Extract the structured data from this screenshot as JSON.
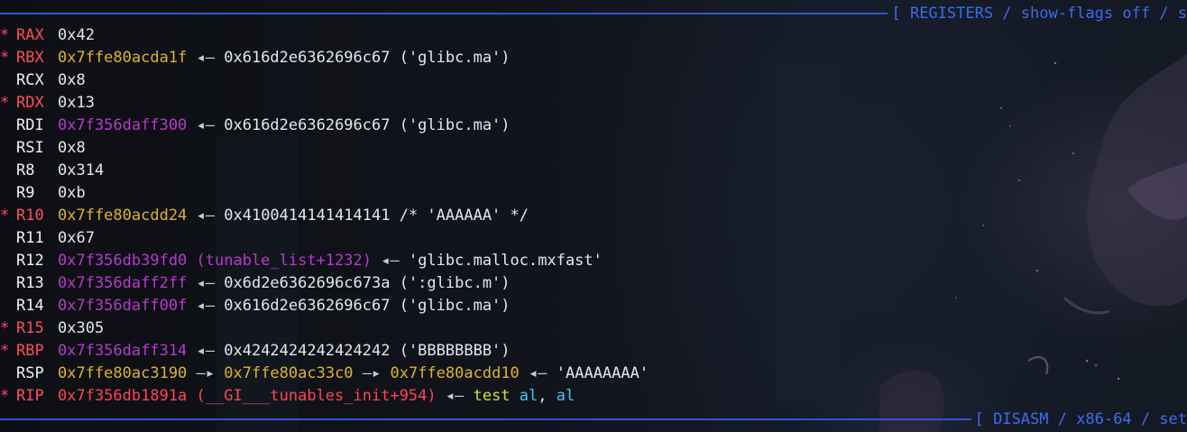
{
  "headers": {
    "registers": "[ REGISTERS / show-flags off / s",
    "disasm": "[ DISASM / x86-64 / set"
  },
  "registers": [
    {
      "changed": true,
      "name": "RAX",
      "value": "0x42",
      "value_kind": "plain",
      "arrow": "",
      "rest": ""
    },
    {
      "changed": true,
      "name": "RBX",
      "value": "0x7ffe80acda1f",
      "value_kind": "stack",
      "arrow": " ◂— ",
      "rest": "0x616d2e6362696c67 ('glibc.ma')"
    },
    {
      "changed": false,
      "name": "RCX",
      "value": "0x8",
      "value_kind": "plain",
      "arrow": "",
      "rest": ""
    },
    {
      "changed": true,
      "name": "RDX",
      "value": "0x13",
      "value_kind": "plain",
      "arrow": "",
      "rest": ""
    },
    {
      "changed": false,
      "name": "RDI",
      "value": "0x7f356daff300",
      "value_kind": "data",
      "arrow": " ◂— ",
      "rest": "0x616d2e6362696c67 ('glibc.ma')"
    },
    {
      "changed": false,
      "name": "RSI",
      "value": "0x8",
      "value_kind": "plain",
      "arrow": "",
      "rest": ""
    },
    {
      "changed": false,
      "name": "R8",
      "value": "0x314",
      "value_kind": "plain",
      "arrow": "",
      "rest": ""
    },
    {
      "changed": false,
      "name": "R9",
      "value": "0xb",
      "value_kind": "plain",
      "arrow": "",
      "rest": ""
    },
    {
      "changed": true,
      "name": "R10",
      "value": "0x7ffe80acdd24",
      "value_kind": "stack",
      "arrow": " ◂— ",
      "rest": "0x4100414141414141 /* 'AAAAAA' */"
    },
    {
      "changed": false,
      "name": "R11",
      "value": "0x67",
      "value_kind": "plain",
      "arrow": "",
      "rest": ""
    },
    {
      "changed": false,
      "name": "R12",
      "value": "0x7f356db39fd0 (tunable_list+1232)",
      "value_kind": "data",
      "arrow": " ◂— ",
      "rest": "'glibc.malloc.mxfast'"
    },
    {
      "changed": false,
      "name": "R13",
      "value": "0x7f356daff2ff",
      "value_kind": "data",
      "arrow": " ◂— ",
      "rest": "0x6d2e6362696c673a (':glibc.m')"
    },
    {
      "changed": false,
      "name": "R14",
      "value": "0x7f356daff00f",
      "value_kind": "data",
      "arrow": " ◂— ",
      "rest": "0x616d2e6362696c67 ('glibc.ma')"
    },
    {
      "changed": true,
      "name": "R15",
      "value": "0x305",
      "value_kind": "plain",
      "arrow": "",
      "rest": ""
    },
    {
      "changed": true,
      "name": "RBP",
      "value": "0x7f356daff314",
      "value_kind": "data",
      "arrow": " ◂— ",
      "rest": "0x4242424242424242 ('BBBBBBBB')"
    },
    {
      "changed": false,
      "name": "RSP",
      "value": "0x7ffe80ac3190",
      "value_kind": "stack",
      "chain": [
        {
          "text": " —▸ ",
          "kind": "arrow"
        },
        {
          "text": "0x7ffe80ac33c0",
          "kind": "stack"
        },
        {
          "text": " —▸ ",
          "kind": "arrow"
        },
        {
          "text": "0x7ffe80acdd10",
          "kind": "stack"
        },
        {
          "text": " ◂— ",
          "kind": "arrow"
        },
        {
          "text": "'AAAAAAAA'",
          "kind": "plain"
        }
      ]
    },
    {
      "changed": true,
      "name": "RIP",
      "value": "0x7f356db1891a (__GI___tunables_init+954)",
      "value_kind": "code",
      "chain": [
        {
          "text": " ◂— ",
          "kind": "arrow"
        },
        {
          "text": "test",
          "kind": "insn"
        },
        {
          "text": " ",
          "kind": "plain"
        },
        {
          "text": "al",
          "kind": "reg"
        },
        {
          "text": ", ",
          "kind": "plain"
        },
        {
          "text": "al",
          "kind": "reg"
        }
      ]
    }
  ],
  "changed_marker": "*",
  "colors": {
    "header": "#3d6bf0",
    "changed_register": "#ff4d5d",
    "stack_address": "#e0b32a",
    "data_address": "#b73acb",
    "code_address": "#ff4452"
  }
}
